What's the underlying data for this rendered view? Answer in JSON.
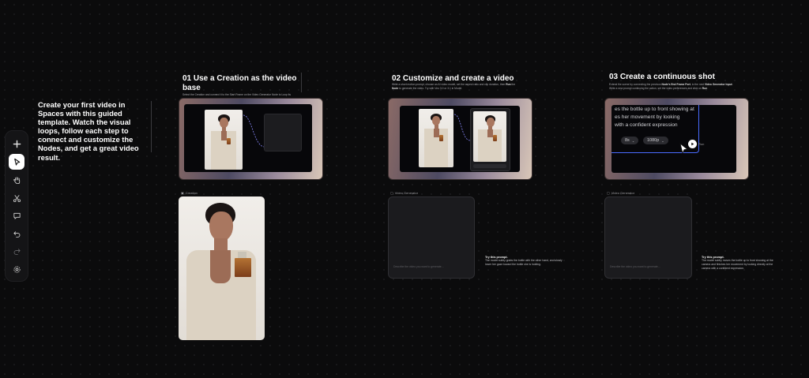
{
  "intro": {
    "text": "Create your first video in Spaces with this guided template. Watch the visual loops, follow each step to connect and customize the Nodes, and get a great video result."
  },
  "toolbar": {
    "items": [
      {
        "icon": "plus-icon",
        "label": "Add"
      },
      {
        "icon": "cursor-icon",
        "label": "Select"
      },
      {
        "icon": "hand-icon",
        "label": "Pan"
      },
      {
        "icon": "scissors-icon",
        "label": "Cut"
      },
      {
        "icon": "comment-icon",
        "label": "Comment"
      },
      {
        "icon": "undo-icon",
        "label": "Undo"
      },
      {
        "icon": "redo-icon",
        "label": "Redo"
      },
      {
        "icon": "settings-icon",
        "label": "Settings"
      }
    ]
  },
  "steps": [
    {
      "title": "01  Use a Creation as the video base",
      "desc": "Select the Creation and connect it to the Start Frame on the Video Generator Node to Loop its"
    },
    {
      "title": "02  Customize and create a video",
      "desc_line1": "Write a short motion prompt, choose an AI video model, set the aspect ratio and clip duration, then",
      "desc_bold1": "Run",
      "desc_line2": "the",
      "desc_bold2": "Node",
      "desc_line3": "to generate the video. Try with Veo 3.0 or 3.1 in Model."
    },
    {
      "title": "03  Create a continuous shot",
      "desc_line1": "Extend the scene by connecting the previous",
      "desc_bold1": "Node's End Frame Port",
      "desc_line2": ", to the next",
      "desc_bold2": "Video Generator Input",
      "desc_line3": ". Write a new prompt continuing the action, set the video preferences and click on",
      "desc_bold3": "Run"
    }
  ],
  "preview3": {
    "text_lines": [
      "es the bottle up to front showing at",
      "es her movement by looking",
      "with a confident expression"
    ],
    "chip_duration": "8s",
    "chip_resolution": "1080p",
    "run_label": "Run"
  },
  "nodes": {
    "creation_label": "Creation",
    "video_gen_1_label": "Video Generator",
    "video_gen_1_placeholder": "Describe the video you want to generate...",
    "video_gen_2_label": "Video Generator",
    "video_gen_2_placeholder": "Describe the video you want to generate..."
  },
  "prompts": [
    {
      "head": "Try this prompt.",
      "body": "The model subtly grabs the bottle with the other hand, and slowly lower her gaze toward the bottle she is holding."
    },
    {
      "head": "Try this prompt.",
      "body": "The model subtly moves the bottle up to front showing at the camera and finishes her movement by looking directly at the camera with a confident expression."
    }
  ]
}
